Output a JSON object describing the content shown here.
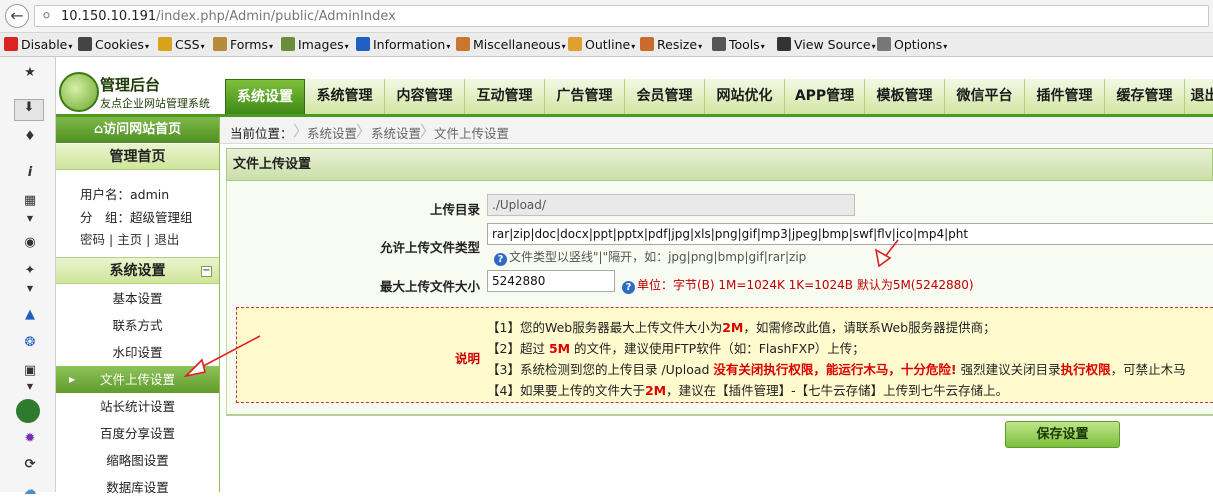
{
  "browser": {
    "url_host": "10.150.10.191",
    "url_path": "/index.php/Admin/public/AdminIndex"
  },
  "webdev_toolbar": [
    {
      "label": "Disable",
      "icon": "no-entry-icon",
      "color": "#d22"
    },
    {
      "label": "Cookies",
      "icon": "person-icon",
      "color": "#444"
    },
    {
      "label": "CSS",
      "icon": "pencil-icon",
      "color": "#d9a21b"
    },
    {
      "label": "Forms",
      "icon": "form-icon",
      "color": "#b58a3b"
    },
    {
      "label": "Images",
      "icon": "image-icon",
      "color": "#6a8e3a"
    },
    {
      "label": "Information",
      "icon": "info-icon",
      "color": "#1f5fbf"
    },
    {
      "label": "Miscellaneous",
      "icon": "box-icon",
      "color": "#c9772e"
    },
    {
      "label": "Outline",
      "icon": "pen-icon",
      "color": "#e0a030"
    },
    {
      "label": "Resize",
      "icon": "ruler-icon",
      "color": "#c96b2d"
    },
    {
      "label": "Tools",
      "icon": "tools-icon",
      "color": "#555"
    },
    {
      "label": "View Source",
      "icon": "monitor-icon",
      "color": "#333"
    },
    {
      "label": "Options",
      "icon": "options-icon",
      "color": "#777"
    }
  ],
  "app": {
    "title": "管理后台",
    "subtitle": "友点企业网站管理系统"
  },
  "nav_tabs": [
    "系统设置",
    "系统管理",
    "内容管理",
    "互动管理",
    "广告管理",
    "会员管理",
    "网站优化",
    "APP管理",
    "模板管理",
    "微信平台",
    "插件管理",
    "缓存管理",
    "退出"
  ],
  "menu": {
    "home_link": "访问网站首页",
    "home_header": "管理首页",
    "user_label": "用户名：admin",
    "group_label": "分　组：超级管理组",
    "links": [
      "密码",
      "主页",
      "退出"
    ],
    "section": "系统设置",
    "collapse": "−",
    "items": [
      "基本设置",
      "联系方式",
      "水印设置",
      "文件上传设置",
      "站长统计设置",
      "百度分享设置",
      "缩略图设置",
      "数据库设置"
    ]
  },
  "breadcrumb": [
    "当前位置：",
    "系统设置",
    "系统设置",
    "文件上传设置"
  ],
  "panel": {
    "title": "文件上传设置",
    "upload_dir_label": "上传目录",
    "upload_dir_value": "./Upload/",
    "types_label": "允许上传文件类型",
    "types_value": "rar|zip|doc|docx|ppt|pptx|pdf|jpg|xls|png|gif|mp3|jpeg|bmp|swf|flv|ico|mp4|pht",
    "types_hint": "文件类型以竖线\"|\"隔开，如：jpg|png|bmp|gif|rar|zip",
    "maxsize_label": "最大上传文件大小",
    "maxsize_value": "5242880",
    "maxsize_hint": "单位：字节(B)  1M=1024K  1K=1024B  默认为5M(5242880)",
    "note_label": "说明",
    "note1_a": "【1】您的Web服务器最大上传文件大小为",
    "note1_b": "2M",
    "note1_c": "，如需修改此值，请联系Web服务器提供商；",
    "note2_a": "【2】超过 ",
    "note2_b": "5M",
    "note2_c": " 的文件，建议使用FTP软件（如：FlashFXP）上传；",
    "note3_a": "【3】系统检测到您的上传目录 /Upload ",
    "note3_b": "没有关闭执行权限，能运行木马，十分危险!",
    "note3_c": "  强烈建议关闭目录",
    "note3_d": "执行权限",
    "note3_e": "，可禁止木马",
    "note4_a": "【4】如果要上传的文件大于",
    "note4_b": "2M",
    "note4_c": "，建议在【插件管理】-【七牛云存储】上传到七牛云存储上。",
    "save": "保存设置"
  }
}
